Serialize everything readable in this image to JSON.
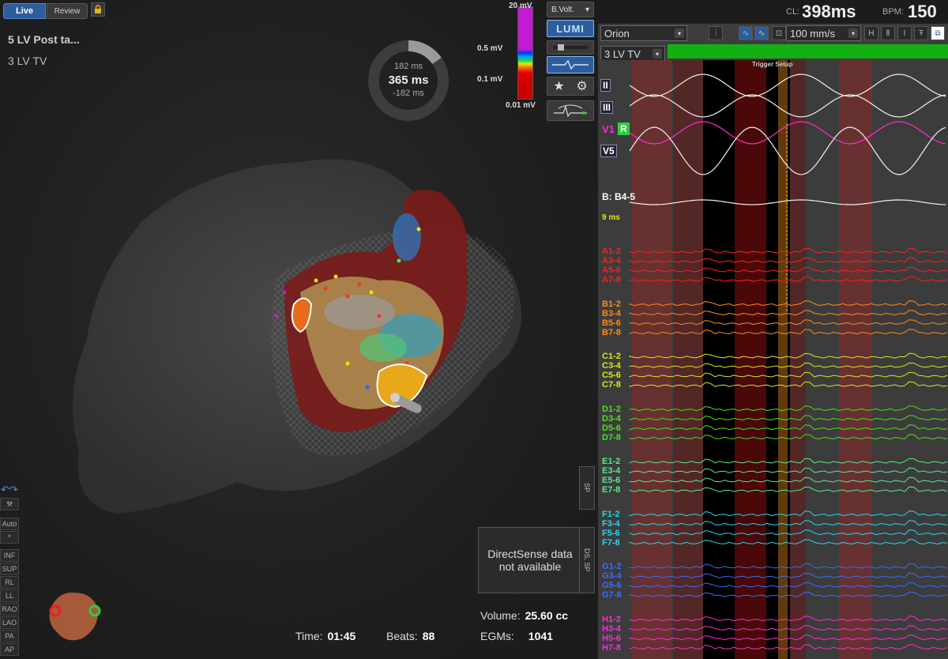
{
  "header": {
    "live_label": "Live",
    "review_label": "Review",
    "map_name": "5 LV Post ta...",
    "map_sub": "3 LV TV"
  },
  "ring": {
    "top": "182 ms",
    "mid": "365 ms",
    "bot": "-182 ms"
  },
  "voltage_bar": {
    "max": "20 mV",
    "hi": "0.5 mV",
    "lo": "0.1 mV",
    "min": "0.01 mV"
  },
  "map_controls": {
    "mode_select": "B.Volt.",
    "lumi": "LUMI"
  },
  "view_toolbar": {
    "auto": "Auto",
    "star": "*",
    "views": [
      "INF",
      "SUP",
      "RL",
      "LL",
      "RAO",
      "LAO",
      "PA",
      "AP"
    ]
  },
  "stats": {
    "time_label": "Time:",
    "time_value": "01:45",
    "beats_label": "Beats:",
    "beats_value": "88",
    "volume_label": "Volume:",
    "volume_value": "25.60 cc",
    "egms_label": "EGMs:",
    "egms_value": "1041"
  },
  "directsense": {
    "line1": "DirectSense data",
    "line2": "not available",
    "tab_ds": "DS, SP",
    "tab_sp": "SP"
  },
  "ecg_header": {
    "cl_label": "CL:",
    "cl_value": "398ms",
    "bpm_label": "BPM:",
    "bpm_value": "150"
  },
  "ecg_controls": {
    "catheter": "Orion",
    "map": "3 LV TV",
    "speed": "100 mm/s",
    "trigger": "Trigger Setup"
  },
  "channels": {
    "surface": [
      "II",
      "III",
      "V1",
      "V5"
    ],
    "ref": "B: B4-5",
    "ref_ms": "9 ms",
    "r_badge": "R",
    "groups": [
      {
        "name": "A",
        "color": "#ff2020",
        "labels": [
          "A1-2",
          "A3-4",
          "A5-6",
          "A7-8"
        ]
      },
      {
        "name": "B",
        "color": "#ff8a1a",
        "labels": [
          "B1-2",
          "B3-4",
          "B5-6",
          "B7-8"
        ]
      },
      {
        "name": "C",
        "color": "#d8e81a",
        "labels": [
          "C1-2",
          "C3-4",
          "C5-6",
          "C7-8"
        ]
      },
      {
        "name": "D",
        "color": "#49e01a",
        "labels": [
          "D1-2",
          "D3-4",
          "D5-6",
          "D7-8"
        ]
      },
      {
        "name": "E",
        "color": "#5ce88a",
        "labels": [
          "E1-2",
          "E3-4",
          "E5-6",
          "E7-8"
        ]
      },
      {
        "name": "F",
        "color": "#28d6f0",
        "labels": [
          "F1-2",
          "F3-4",
          "F5-6",
          "F7-8"
        ]
      },
      {
        "name": "G",
        "color": "#3a6cff",
        "labels": [
          "G1-2",
          "G3-4",
          "G5-6",
          "G7-8"
        ]
      },
      {
        "name": "H",
        "color": "#ff2ad8",
        "labels": [
          "H1-2",
          "H3-4",
          "H5-6",
          "H7-8"
        ]
      }
    ]
  },
  "colors": {
    "live": "#2e5d9c",
    "green_bar": "#12b012",
    "ref_highlight": "#ff4040"
  }
}
